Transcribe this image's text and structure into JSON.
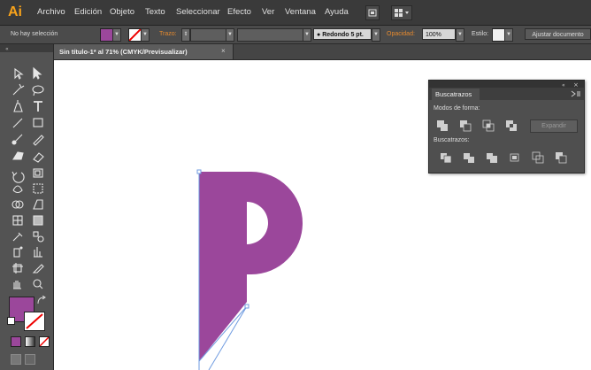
{
  "app": {
    "logo": "Ai"
  },
  "menu": [
    "Archivo",
    "Edición",
    "Objeto",
    "Texto",
    "Seleccionar",
    "Efecto",
    "Ver",
    "Ventana",
    "Ayuda"
  ],
  "control_bar": {
    "selection": "No hay selección",
    "fill_color": "#9b479b",
    "stroke_label": "Trazo:",
    "brush_label": "Redondo 5 pt.",
    "opacity_label": "Opacidad:",
    "opacity_value": "100%",
    "style_label": "Estilo:",
    "adjust_button": "Ajustar documento"
  },
  "document": {
    "tab_title": "Sin título-1* al 71% (CMYK/Previsualizar)",
    "close": "×"
  },
  "tools": {
    "fill_color": "#9b479b",
    "shape_color": "#9b479b"
  },
  "pathfinder": {
    "title": "Buscatrazos",
    "shape_modes_label": "Modos de forma:",
    "pathfinders_label": "Buscatrazos:",
    "expand_button": "Expandir"
  },
  "colors": {
    "accent": "#f7a21b",
    "shape": "#9b479b",
    "guide": "#6f9be0"
  }
}
